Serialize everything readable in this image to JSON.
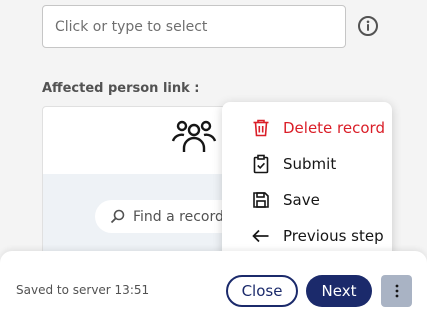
{
  "form": {
    "select_placeholder": "Click or type to select",
    "affected_label": "Affected person link :",
    "search_placeholder": "Find a record to"
  },
  "menu": {
    "items": [
      {
        "label": "Delete record",
        "icon": "trash-icon",
        "color": "#da1e28"
      },
      {
        "label": "Submit",
        "icon": "clipboard-check-icon"
      },
      {
        "label": "Save",
        "icon": "floppy-disk-icon"
      },
      {
        "label": "Previous step",
        "icon": "arrow-left-icon"
      }
    ]
  },
  "footer": {
    "status": "Saved to server 13:51",
    "close_label": "Close",
    "next_label": "Next",
    "more_icon": "vertical-dots-icon"
  },
  "colors": {
    "primary": "#1b2a6b",
    "danger": "#da1e28",
    "more_button": "#a9b3c4"
  }
}
